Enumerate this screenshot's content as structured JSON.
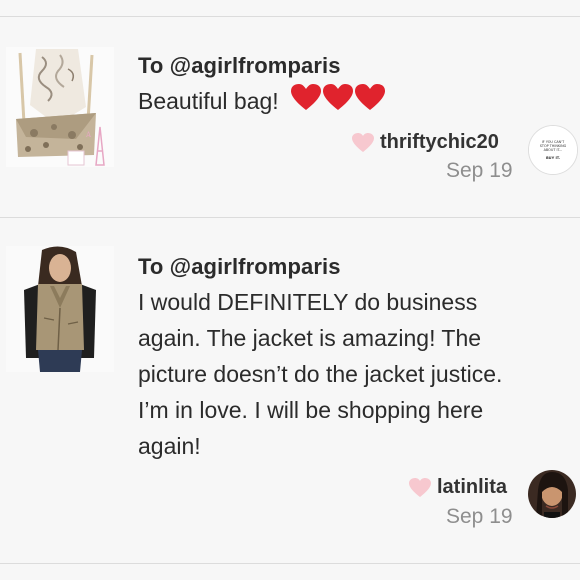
{
  "reviews": [
    {
      "to": "To @agirlfromparis",
      "message": "Beautiful bag!",
      "author": "thriftychic20",
      "date": "Sep 19",
      "avatar_text": "IF YOU CAN'T STOP THINKING ABOUT IT... BUY IT.",
      "item_icon": "snakeskin-bag",
      "emoji": "red-heart x3"
    },
    {
      "to": "To @agirlfromparis",
      "message_lines": [
        "I would DEFINITELY do business",
        "again. The jacket is amazing! The",
        "picture doesn’t do the jacket justice.",
        "I’m in love. I will be shopping here",
        "again!"
      ],
      "author": "latinlita",
      "date": "Sep 19",
      "item_icon": "moto-jacket"
    }
  ],
  "colors": {
    "heart_pink": "#f7c8cf",
    "heart_red": "#e0232d",
    "date_gray": "#8e8e8e",
    "text": "#2b2b2b"
  }
}
